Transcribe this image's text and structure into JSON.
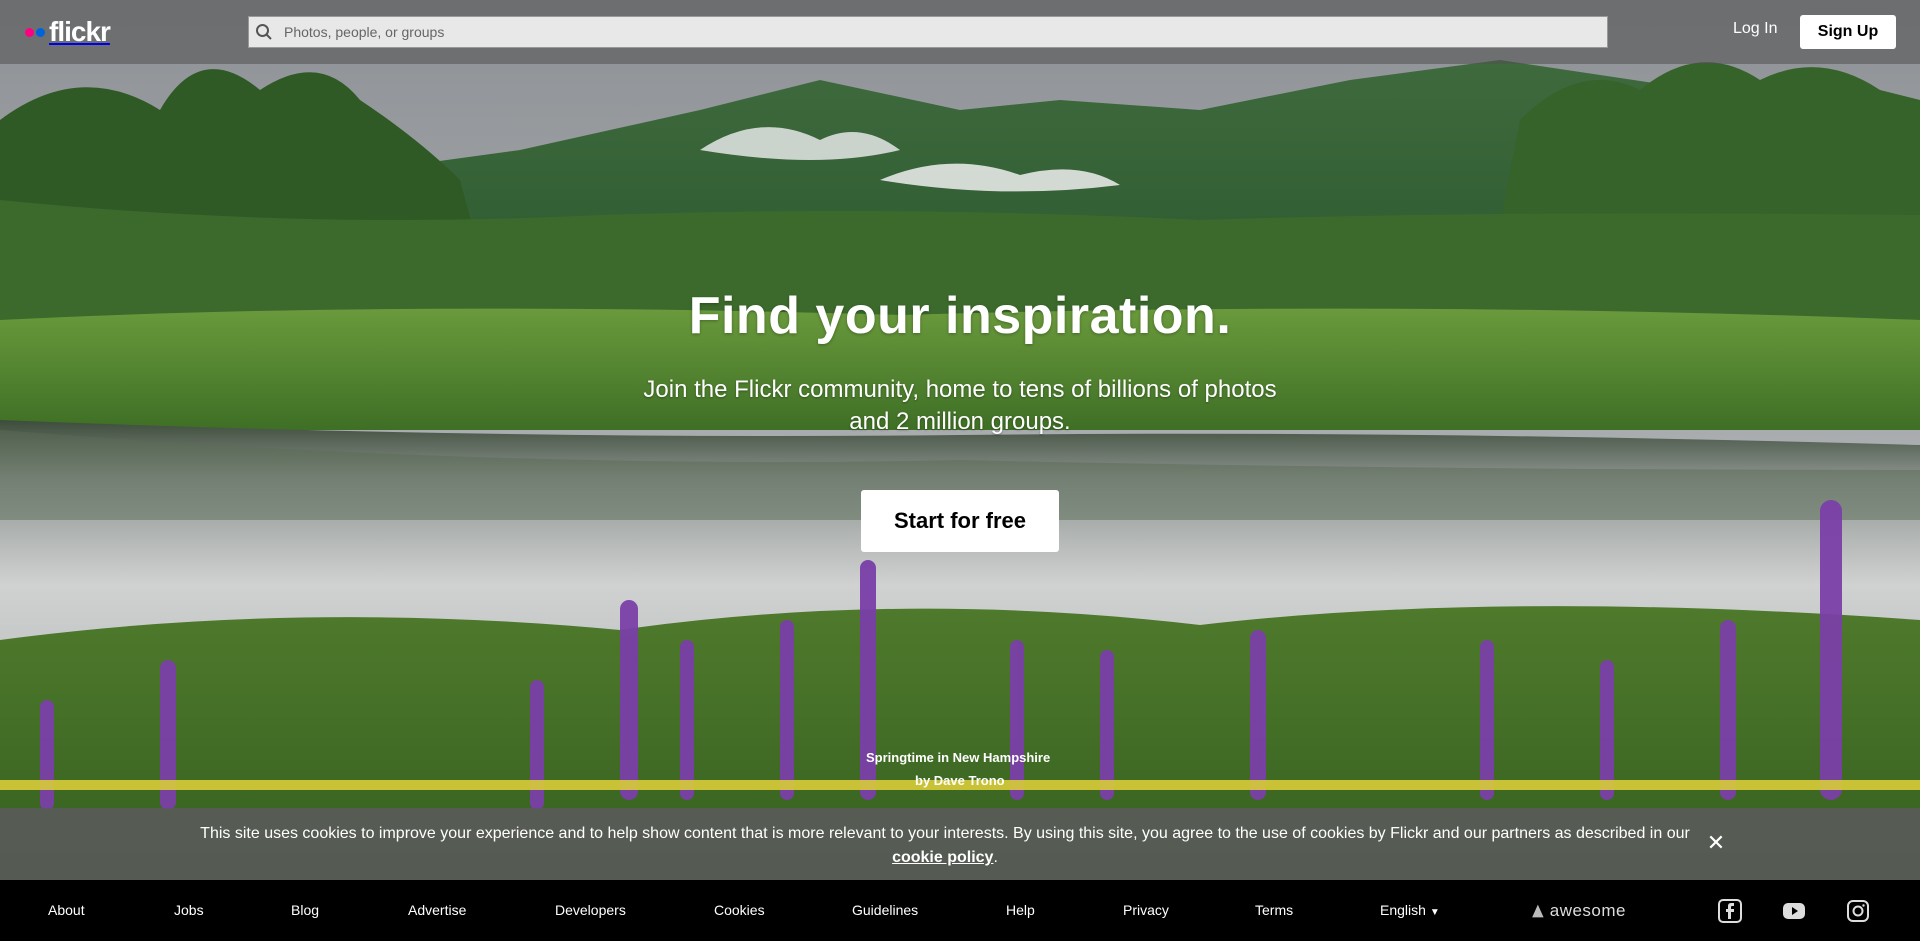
{
  "header": {
    "logo_text": "flickr",
    "logo_dot_colors": [
      "#ff0084",
      "#0063dc"
    ],
    "search_placeholder": "Photos, people, or groups",
    "login_label": "Log In",
    "signup_label": "Sign Up"
  },
  "hero": {
    "title": "Find your inspiration.",
    "subtitle": "Join the Flickr community, home to tens of billions of photos and 2 million groups.",
    "cta_label": "Start for free"
  },
  "photo_credit": {
    "title": "Springtime in New Hampshire",
    "byline": "by Dave Trono"
  },
  "cookie_banner": {
    "text": "This site uses cookies to improve your experience and to help show content that is more relevant to your interests. By using this site, you agree to the use of cookies by Flickr and our partners as described in our",
    "link_label": "cookie policy",
    "trailing": ".",
    "close_icon": "close-icon"
  },
  "footer": {
    "links": [
      "About",
      "Jobs",
      "Blog",
      "Advertise",
      "Developers",
      "Cookies",
      "Guidelines",
      "Help",
      "Privacy",
      "Terms"
    ],
    "language": "English",
    "awesome_label": "awesome",
    "social_icons": [
      "facebook-icon",
      "youtube-icon",
      "instagram-icon"
    ]
  }
}
